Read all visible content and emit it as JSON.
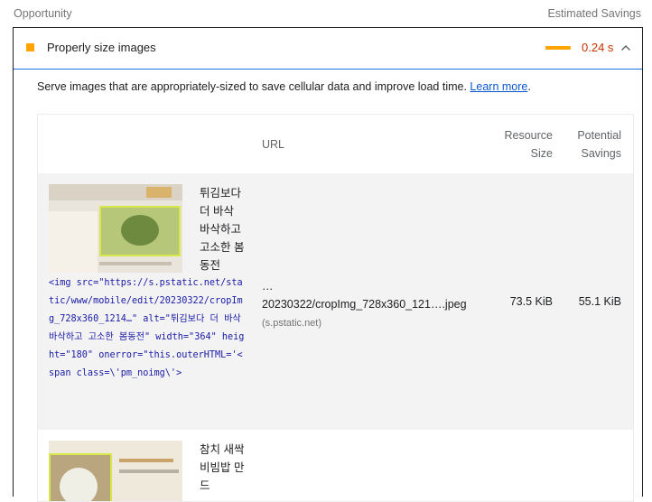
{
  "header": {
    "left_label": "Opportunity",
    "right_label": "Estimated Savings"
  },
  "audit": {
    "title": "Properly size images",
    "savings": "0.24 s",
    "description": "Serve images that are appropriately-sized to save cellular data and improve load time. ",
    "learn_more": "Learn more",
    "period": ".",
    "status_color": "#ffa400",
    "savings_color": "#c33300"
  },
  "table": {
    "columns": {
      "url": "URL",
      "resource_size": "Resource Size",
      "potential_savings": "Potential Savings"
    },
    "rows": [
      {
        "alt": "튀김보다 더 바삭 바삭하고 고소한 봄동전",
        "code": "<img src=\"https://s.pstatic.net/static/www/mobile/edit/20230322/cropImg_728x360_1214…\" alt=\"튀김보다 더 바삭바삭하고 고소한 봄동전\" width=\"364\" height=\"180\" onerror=\"this.outerHTML='<span class=\\'pm_noimg\\'>",
        "url_prefix": "…",
        "url_main": "20230322/cropImg_728x360_121….jpeg",
        "url_host": "(s.pstatic.net)",
        "resource_size": "73.5 KiB",
        "potential_savings": "55.1 KiB"
      },
      {
        "alt": "참치 새싹 비빔밥 만드"
      }
    ]
  }
}
